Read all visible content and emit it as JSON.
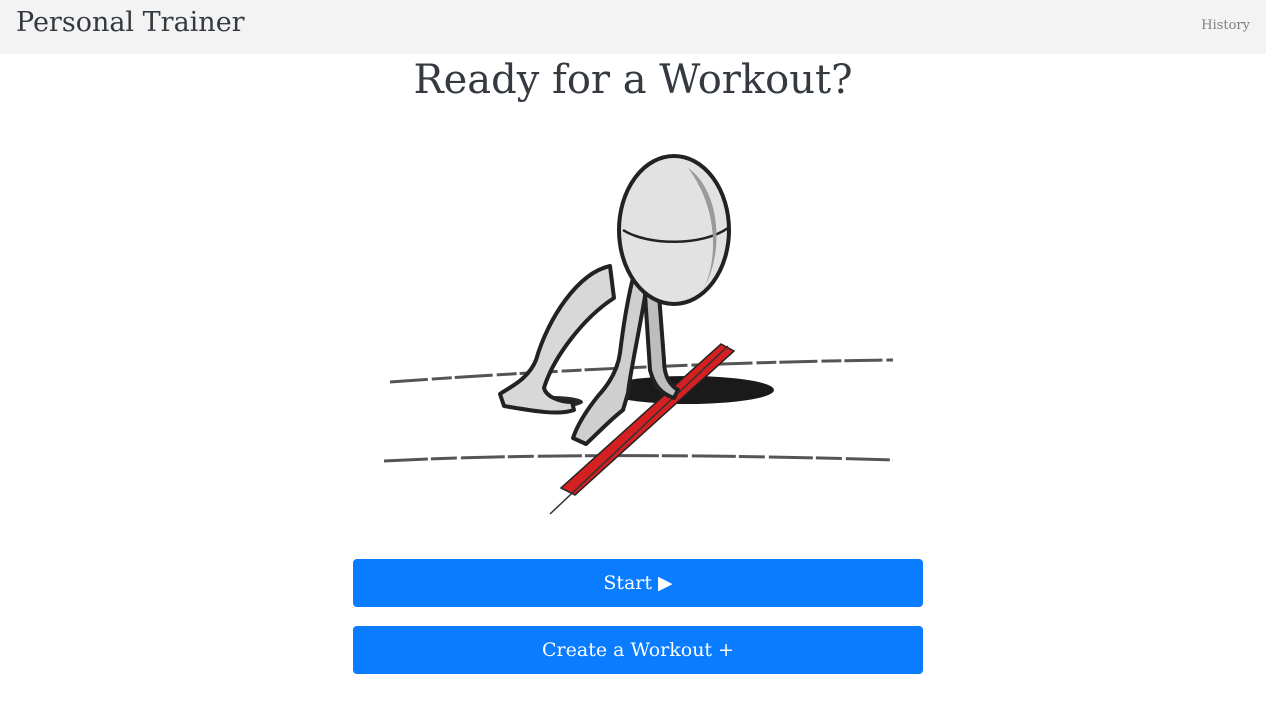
{
  "navbar": {
    "brand": "Personal Trainer",
    "history_link": "History"
  },
  "main": {
    "title": "Ready for a Workout?",
    "start_button": {
      "label": "Start",
      "icon": "play-icon",
      "glyph": "▶"
    },
    "create_button": {
      "label": "Create a Workout",
      "icon": "plus-icon",
      "glyph": "+"
    }
  },
  "colors": {
    "primary": "#0a7cff",
    "navbar_bg": "#f3f3f3",
    "finish_line": "#d42020"
  }
}
